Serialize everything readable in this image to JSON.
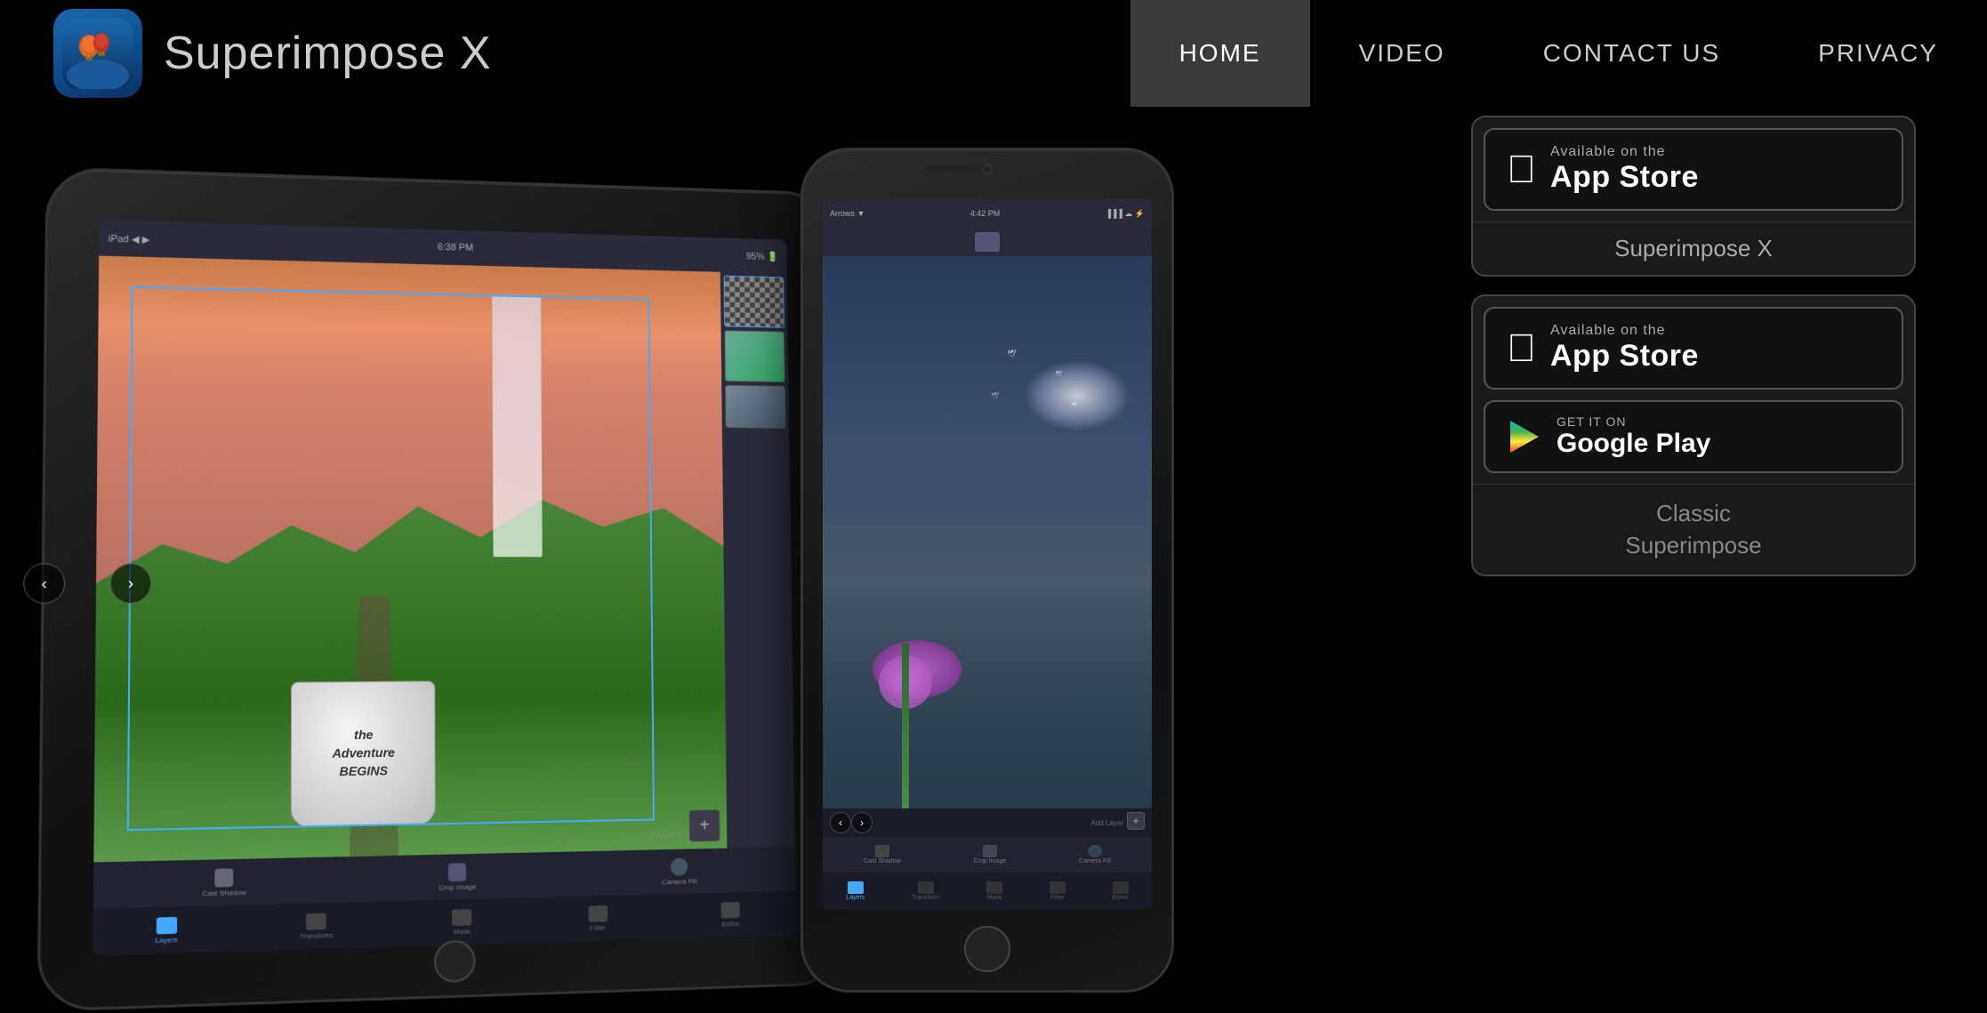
{
  "nav": {
    "logo_title": "Superimpose X",
    "links": [
      {
        "label": "HOME",
        "active": true
      },
      {
        "label": "VIDEO",
        "active": false
      },
      {
        "label": "CONTACT US",
        "active": false
      },
      {
        "label": "PRIVACY",
        "active": false
      }
    ]
  },
  "devices": {
    "ipad": {
      "layers": [
        "checkerboard",
        "photo",
        "small-photo"
      ],
      "bottom_tabs": [
        "Layers",
        "Transform",
        "Mask",
        "Filter",
        "Editor"
      ]
    },
    "iphone": {
      "bottom_tabs": [
        "Layers",
        "Transform",
        "Mask",
        "Filter",
        "Editor"
      ]
    }
  },
  "store_top": {
    "button_subtitle": "Available on the",
    "button_title": "App Store",
    "app_name": "Superimpose X",
    "apple_icon": ""
  },
  "store_bottom": {
    "apple_button_subtitle": "Available on the",
    "apple_button_title": "App Store",
    "google_button_subtitle": "GET IT ON",
    "google_button_title": "Google Play",
    "classic_name_line1": "Classic",
    "classic_name_line2": "Superimpose"
  }
}
